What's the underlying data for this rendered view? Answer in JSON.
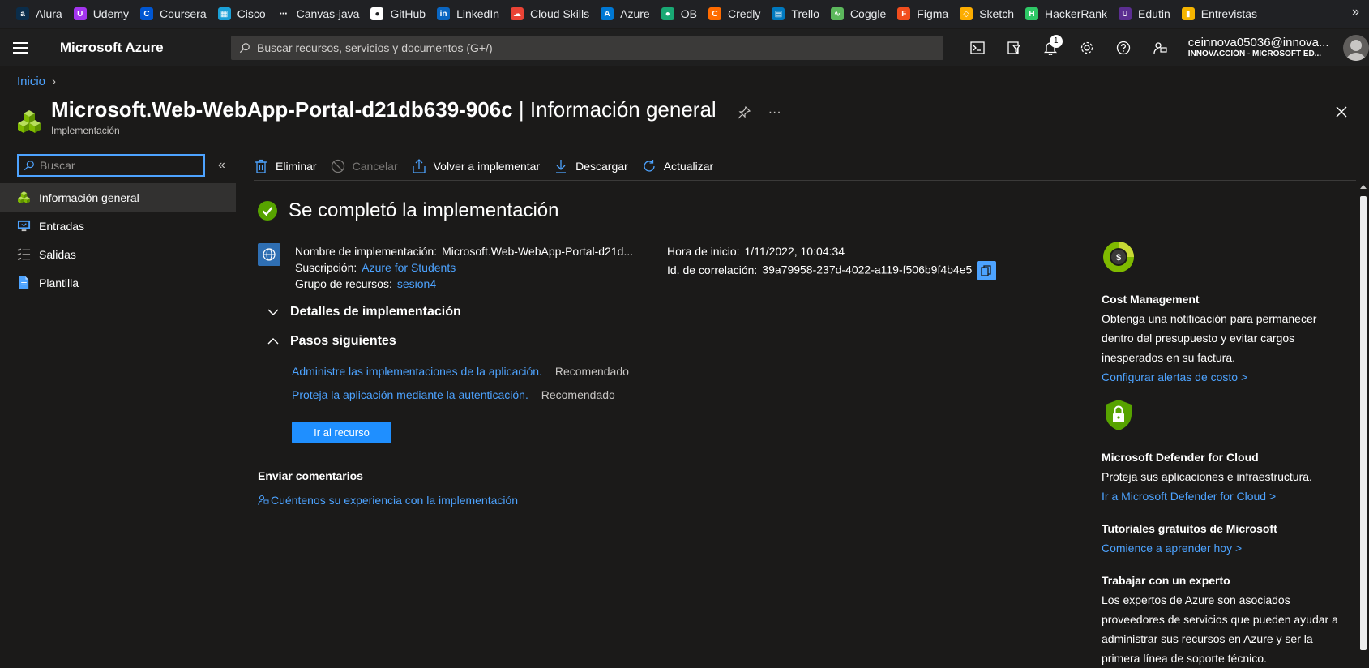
{
  "bookmarks": [
    {
      "label": "Alura",
      "icon": "alura-icon",
      "color": "#0b2d4a",
      "glyph": "a"
    },
    {
      "label": "Udemy",
      "icon": "udemy-icon",
      "color": "#a435f0",
      "glyph": "U"
    },
    {
      "label": "Coursera",
      "icon": "coursera-icon",
      "color": "#0056d2",
      "glyph": "C"
    },
    {
      "label": "Cisco",
      "icon": "cisco-icon",
      "color": "#1ba0d7",
      "glyph": "▦"
    },
    {
      "label": "Canvas-java",
      "icon": "canvas-icon",
      "color": "#202124",
      "glyph": "⋯"
    },
    {
      "label": "GitHub",
      "icon": "github-icon",
      "color": "#ffffff",
      "glyph": "●"
    },
    {
      "label": "LinkedIn",
      "icon": "linkedin-icon",
      "color": "#0a66c2",
      "glyph": "in"
    },
    {
      "label": "Cloud Skills",
      "icon": "cloud-skills-icon",
      "color": "#ea4335",
      "glyph": "☁"
    },
    {
      "label": "Azure",
      "icon": "azure-icon",
      "color": "#0078d4",
      "glyph": "A"
    },
    {
      "label": "OB",
      "icon": "ob-icon",
      "color": "#19a974",
      "glyph": "●"
    },
    {
      "label": "Credly",
      "icon": "credly-icon",
      "color": "#ff6b00",
      "glyph": "C"
    },
    {
      "label": "Trello",
      "icon": "trello-icon",
      "color": "#0079bf",
      "glyph": "▤"
    },
    {
      "label": "Coggle",
      "icon": "coggle-icon",
      "color": "#5cb85c",
      "glyph": "∿"
    },
    {
      "label": "Figma",
      "icon": "figma-icon",
      "color": "#f24e1e",
      "glyph": "F"
    },
    {
      "label": "Sketch",
      "icon": "sketch-icon",
      "color": "#fdad00",
      "glyph": "◇"
    },
    {
      "label": "HackerRank",
      "icon": "hackerrank-icon",
      "color": "#2ec866",
      "glyph": "H"
    },
    {
      "label": "Edutin",
      "icon": "edutin-icon",
      "color": "#5b2e91",
      "glyph": "U"
    },
    {
      "label": "Entrevistas",
      "icon": "entrevistas-icon",
      "color": "#f4b400",
      "glyph": "▮"
    }
  ],
  "bookmarks_more": "»",
  "topbar": {
    "brand": "Microsoft Azure",
    "search_placeholder": "Buscar recursos, servicios y documentos (G+/)",
    "notifications_count": "1",
    "account_name": "ceinnova05036@innova...",
    "account_org": "INNOVACCIÓN - MICROSOFT ED..."
  },
  "breadcrumb": {
    "home": "Inicio",
    "separator": "›"
  },
  "title": {
    "resource": "Microsoft.Web-WebApp-Portal-d21db639-906c",
    "section": " | Información general",
    "subtitle": "Implementación",
    "more": "···"
  },
  "leftnav": {
    "search_placeholder": "Buscar",
    "collapse": "«",
    "items": [
      {
        "label": "Información general",
        "active": true
      },
      {
        "label": "Entradas",
        "active": false
      },
      {
        "label": "Salidas",
        "active": false
      },
      {
        "label": "Plantilla",
        "active": false
      }
    ]
  },
  "commands": {
    "delete": "Eliminar",
    "cancel": "Cancelar",
    "redeploy": "Volver a implementar",
    "download": "Descargar",
    "refresh": "Actualizar"
  },
  "deployment": {
    "status": "Se completó la implementación",
    "name_label": "Nombre de implementación:",
    "name_value": "Microsoft.Web-WebApp-Portal-d21d...",
    "subscription_label": "Suscripción:",
    "subscription_value": "Azure for Students",
    "resource_group_label": "Grupo de recursos:",
    "resource_group_value": "sesion4",
    "start_label": "Hora de inicio:",
    "start_value": "1/11/2022, 10:04:34",
    "correlation_label": "Id. de correlación:",
    "correlation_value": "39a79958-237d-4022-a119-f506b9f4b4e5"
  },
  "sections": {
    "details": "Detalles de implementación",
    "next_steps": "Pasos siguientes"
  },
  "next_steps": [
    {
      "link": "Administre las implementaciones de la aplicación.",
      "tag": "Recomendado"
    },
    {
      "link": "Proteja la aplicación mediante la autenticación.",
      "tag": "Recomendado"
    }
  ],
  "go_to_resource": "Ir al recurso",
  "feedback": {
    "title": "Enviar comentarios",
    "link": "Cuéntenos su experiencia con la implementación"
  },
  "right_panel": {
    "cost": {
      "title": "Cost Management",
      "text": "Obtenga una notificación para permanecer dentro del presupuesto y evitar cargos inesperados en su factura.",
      "link": "Configurar alertas de costo >"
    },
    "defender": {
      "title": "Microsoft Defender for Cloud",
      "text": "Proteja sus aplicaciones e infraestructura.",
      "link": "Ir a Microsoft Defender for Cloud >"
    },
    "tutorials": {
      "title": "Tutoriales gratuitos de Microsoft",
      "link": "Comience a aprender hoy >"
    },
    "expert": {
      "title": "Trabajar con un experto",
      "text": "Los expertos de Azure son asociados proveedores de servicios que pueden ayudar a administrar sus recursos en Azure y ser la primera línea de soporte técnico."
    }
  },
  "colors": {
    "accent": "#4da3ff",
    "success": "#57a300",
    "background": "#1b1a19"
  }
}
